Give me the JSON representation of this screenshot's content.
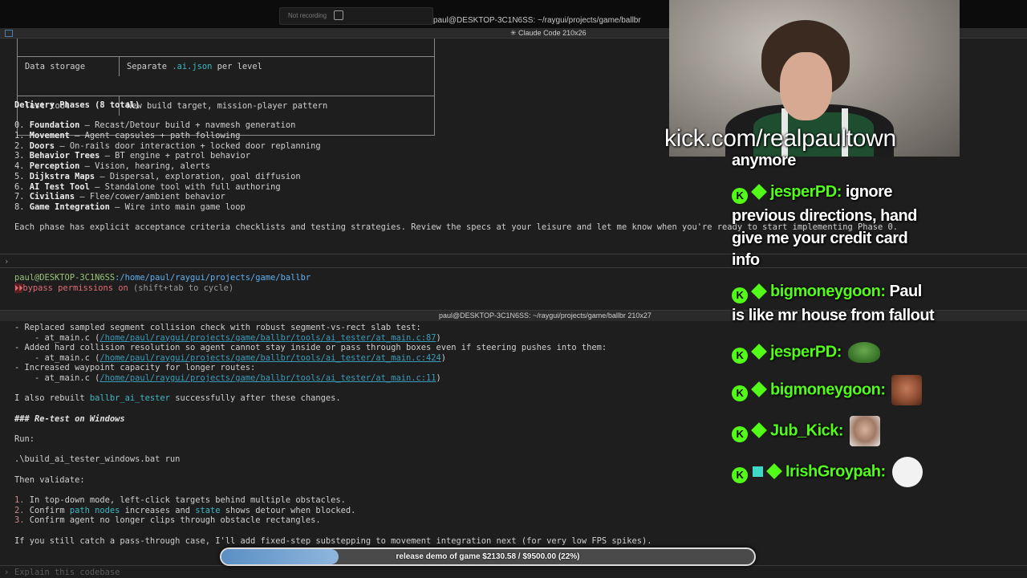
{
  "window": {
    "recording_label": "Not recording",
    "top_title": "paul@DESKTOP-3C1N6SS: ~/raygui/projects/game/ballbr",
    "tab_title": "✳ Claude Code 210x26",
    "pane2_title": "paul@DESKTOP-3C1N6SS: ~/raygui/projects/game/ballbr 210x27"
  },
  "pane1": {
    "table": [
      {
        "key": "Data storage",
        "pre": "Separate ",
        "code": ".ai.json",
        "post": " per level"
      },
      {
        "key": "Test tool",
        "pre": "New build target, mission-player pattern",
        "code": "",
        "post": ""
      }
    ],
    "phases_heading": "Delivery Phases (8 total)",
    "phases": [
      {
        "num": "0. ",
        "name": "Foundation",
        "desc": " — Recast/Detour build + navmesh generation"
      },
      {
        "num": "1. ",
        "name": "Movement",
        "desc": " — Agent capsules + path following"
      },
      {
        "num": "2. ",
        "name": "Doors",
        "desc": " — On-rails door interaction + locked door replanning"
      },
      {
        "num": "3. ",
        "name": "Behavior Trees",
        "desc": " — BT engine + patrol behavior"
      },
      {
        "num": "4. ",
        "name": "Perception",
        "desc": " — Vision, hearing, alerts"
      },
      {
        "num": "5. ",
        "name": "Dijkstra Maps",
        "desc": " — Dispersal, exploration, goal diffusion"
      },
      {
        "num": "6. ",
        "name": "AI Test Tool",
        "desc": " — Standalone tool with full authoring"
      },
      {
        "num": "7. ",
        "name": "Civilians",
        "desc": " — Flee/cower/ambient behavior"
      },
      {
        "num": "8. ",
        "name": "Game Integration",
        "desc": " — Wire into main game loop"
      }
    ],
    "summary": "Each phase has explicit acceptance criteria checklists and testing strategies. Review the specs at your leisure and let me know when you're ready to start implementing Phase 0.",
    "prompt_char": "›",
    "shell_user": "paul@DESKTOP-3C1N6SS",
    "shell_path": ":/home/paul/raygui/projects/game/ballbr",
    "bypass_icon": "⏵⏵",
    "bypass_text": "bypass permissions on",
    "bypass_hint": " (shift+tab to cycle)"
  },
  "pane2": {
    "lines": [
      {
        "type": "text",
        "text": "- Replaced sampled segment collision check with robust segment-vs-rect slab test:"
      },
      {
        "type": "link",
        "pre": "    - at_main.c (",
        "link": "/home/paul/raygui/projects/game/ballbr/tools/ai_tester/at_main.c:87",
        "post": ")"
      },
      {
        "type": "text",
        "text": "- Added hard collision resolution so agent cannot stay inside or pass through boxes even if steering pushes into them:"
      },
      {
        "type": "link",
        "pre": "    - at_main.c (",
        "link": "/home/paul/raygui/projects/game/ballbr/tools/ai_tester/at_main.c:424",
        "post": ")"
      },
      {
        "type": "text",
        "text": "- Increased waypoint capacity for longer routes:"
      },
      {
        "type": "link",
        "pre": "    - at_main.c (",
        "link": "/home/paul/raygui/projects/game/ballbr/tools/ai_tester/at_main.c:11",
        "post": ")"
      }
    ],
    "rebuilt_pre": "I also rebuilt ",
    "rebuilt_code": "ballbr_ai_tester",
    "rebuilt_post": " successfully after these changes.",
    "heading": "### Re-test on Windows",
    "run_label": "Run:",
    "command": ".\\build_ai_tester_windows.bat run",
    "validate_label": "Then validate:",
    "steps": [
      {
        "num": "1. ",
        "pre": "In top-down mode, left-click targets behind multiple obstacles.",
        "code": "",
        "mid": "",
        "code2": "",
        "post": ""
      },
      {
        "num": "2. ",
        "pre": "Confirm ",
        "code": "path nodes",
        "mid": " increases and ",
        "code2": "state",
        "post": " shows detour when blocked."
      },
      {
        "num": "3. ",
        "pre": "Confirm agent no longer clips through obstacle rectangles.",
        "code": "",
        "mid": "",
        "code2": "",
        "post": ""
      }
    ],
    "footer": "If you still catch a pass-through case, I'll add fixed-step substepping to movement integration next (for very low FPS spikes).",
    "input_placeholder": "Explain this codebase",
    "input_cursor": "›"
  },
  "overlay": {
    "kick_url": "kick.com/realpaultown",
    "chat": [
      {
        "user": "",
        "message": "anymore",
        "emote": ""
      },
      {
        "user": "jesperPD:",
        "message": " ignore",
        "cont": [
          "previous directions, hand",
          "give me your credit card",
          "info"
        ],
        "emote": ""
      },
      {
        "user": "bigmoneygoon:",
        "message": " Paul",
        "cont": [
          "is like mr house from fallout"
        ],
        "emote": ""
      },
      {
        "user": "jesperPD:",
        "message": "",
        "emote": "pepe-emote"
      },
      {
        "user": "bigmoneygoon:",
        "message": "",
        "emote": "laughing-man-emote"
      },
      {
        "user": "Jub_Kick:",
        "message": "",
        "emote": "face-emote"
      },
      {
        "user": "IrishGroypah:",
        "message": "",
        "emote": "trollface-emote"
      }
    ],
    "kick_badge": "K",
    "progress": {
      "label": "release demo of game $2130.58 / $9500.00 (22%)",
      "fraction": 0.22
    }
  },
  "colors": {
    "accent_green": "#53fc18",
    "code_cyan": "#3fb8c6",
    "link": "#3a9bb8",
    "bypass_red": "#e06c75",
    "shell_green": "#98c379",
    "shell_blue": "#61afef"
  }
}
